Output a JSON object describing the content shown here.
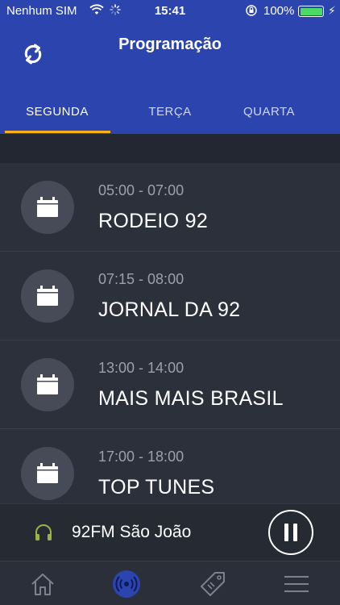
{
  "status_bar": {
    "carrier": "Nenhum SIM",
    "time": "15:41",
    "battery": "100%"
  },
  "header": {
    "title": "Programação",
    "refresh_icon": "refresh-icon"
  },
  "tabs": [
    {
      "label": "SEGUNDA",
      "active": true
    },
    {
      "label": "TERÇA",
      "active": false
    },
    {
      "label": "QUARTA",
      "active": false
    }
  ],
  "programs": [
    {
      "time": "05:00 - 07:00",
      "name": "RODEIO 92"
    },
    {
      "time": "07:15 - 08:00",
      "name": "JORNAL DA 92"
    },
    {
      "time": "13:00 - 14:00",
      "name": "MAIS MAIS BRASIL"
    },
    {
      "time": "17:00 - 18:00",
      "name": "TOP TUNES"
    }
  ],
  "player": {
    "station": "92FM São João",
    "state": "playing"
  },
  "bottom_nav": [
    {
      "icon": "home-icon",
      "active": false
    },
    {
      "icon": "radio-icon",
      "active": true
    },
    {
      "icon": "tag-icon",
      "active": false
    },
    {
      "icon": "menu-icon",
      "active": false
    }
  ],
  "colors": {
    "header_bg": "#2c44ad",
    "tab_indicator": "#f3b21b",
    "list_bg": "#2c303b",
    "active_nav": "#2c44ad"
  }
}
